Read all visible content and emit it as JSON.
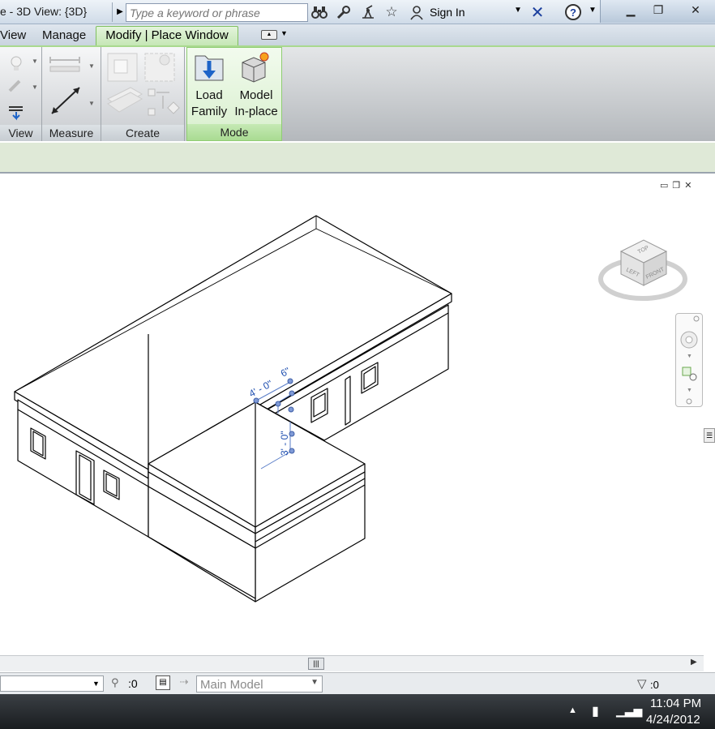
{
  "titlebar": {
    "title": "e - 3D View: {3D}",
    "search_placeholder": "Type a keyword or phrase",
    "sign_in": "Sign In",
    "icons": [
      "binoculars-icon",
      "wrench-icon",
      "satellite-icon",
      "star-icon",
      "user-icon",
      "exchange-x-icon",
      "help-icon"
    ]
  },
  "ribbon_tabs": {
    "view": "View",
    "manage": "Manage",
    "modify_place_window": "Modify | Place Window"
  },
  "ribbon": {
    "panels": {
      "view": "View",
      "measure": "Measure",
      "create": "Create",
      "mode": "Mode"
    },
    "buttons": {
      "load_family_line1": "Load",
      "load_family_line2": "Family",
      "model_inplace_line1": "Model",
      "model_inplace_line2": "In-place"
    }
  },
  "canvas": {
    "dimensions": {
      "dim_a": "4' - 0\"",
      "dim_b": "6\"",
      "dim_c": "3' - 0\""
    },
    "viewcube": {
      "top": "TOP",
      "left": "LEFT",
      "front": "FRONT"
    }
  },
  "statusbar": {
    "editable_count": ":0",
    "workset": "Main Model",
    "filter_count": ":0"
  },
  "taskbar": {
    "time": "11:04 PM",
    "date": "4/24/2012"
  },
  "colors": {
    "ribbon_accent": "#8fcd72",
    "options_bar": "#dfe9d7",
    "dimension_blue": "#1f4fb0",
    "taskbar": "#1a1d20"
  }
}
